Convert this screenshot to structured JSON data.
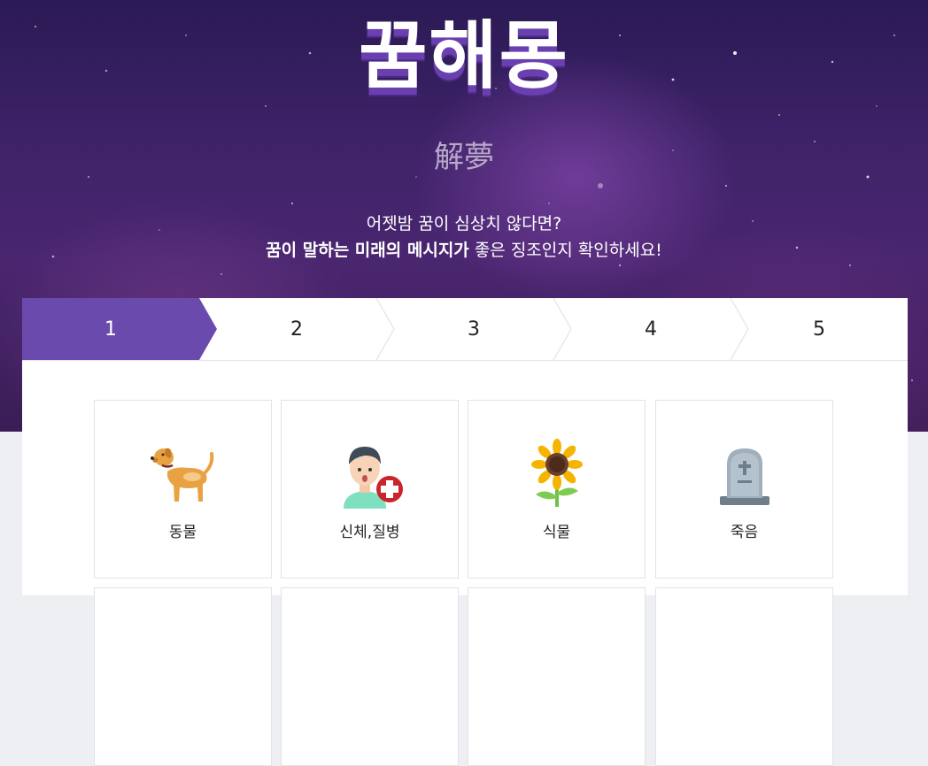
{
  "header": {
    "logo": "꿈해몽",
    "subtitle": "解夢",
    "tagline_line1": "어젯밤 꿈이 심상치 않다면?",
    "tagline_bold": "꿈이 말하는 미래의 메시지가",
    "tagline_rest": " 좋은 징조인지 확인하세요!"
  },
  "steps": {
    "active": 1,
    "items": [
      "1",
      "2",
      "3",
      "4",
      "5"
    ],
    "active_color": "#6a4aad"
  },
  "categories": [
    {
      "label": "동물",
      "icon": "dog-icon"
    },
    {
      "label": "신체,질병",
      "icon": "sick-person-icon"
    },
    {
      "label": "식물",
      "icon": "sunflower-icon"
    },
    {
      "label": "죽음",
      "icon": "gravestone-icon"
    }
  ]
}
